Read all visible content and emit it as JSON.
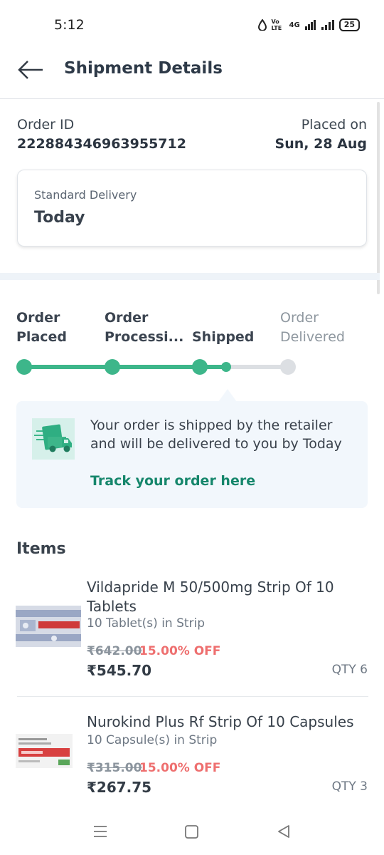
{
  "status_bar": {
    "time": "5:12",
    "network": "4G",
    "volte": "Vo LTE",
    "battery": "25"
  },
  "header": {
    "title": "Shipment Details"
  },
  "order": {
    "id_label": "Order ID",
    "id_value": "222884346963955712",
    "placed_label": "Placed on",
    "placed_value": "Sun, 28 Aug"
  },
  "delivery": {
    "type": "Standard Delivery",
    "day": "Today"
  },
  "progress": {
    "steps": [
      {
        "line1": "Order",
        "line2": "Placed",
        "state": "done"
      },
      {
        "line1": "Order",
        "line2": "Processi...",
        "state": "done"
      },
      {
        "line1": "",
        "line2": "Shipped",
        "state": "current"
      },
      {
        "line1": "Order",
        "line2": "Delivered",
        "state": "pending"
      }
    ],
    "active_color": "#3db68a",
    "inactive_color": "#dcdfe3"
  },
  "status_message": {
    "text": "Your order is shipped by the retailer and will be delivered to you by Today",
    "link": "Track your order here"
  },
  "items_title": "Items",
  "items": [
    {
      "name": "Vildapride M 50/500mg Strip Of 10 Tablets",
      "pack": "10 Tablet(s) in Strip",
      "mrp": "₹642.00",
      "discount": "15.00% OFF",
      "price": "₹545.70",
      "qty": "QTY 6"
    },
    {
      "name": "Nurokind Plus Rf Strip Of 10 Capsules",
      "pack": "10 Capsule(s) in Strip",
      "mrp": "₹315.00",
      "discount": "15.00% OFF",
      "price": "₹267.75",
      "qty": "QTY 3"
    }
  ]
}
